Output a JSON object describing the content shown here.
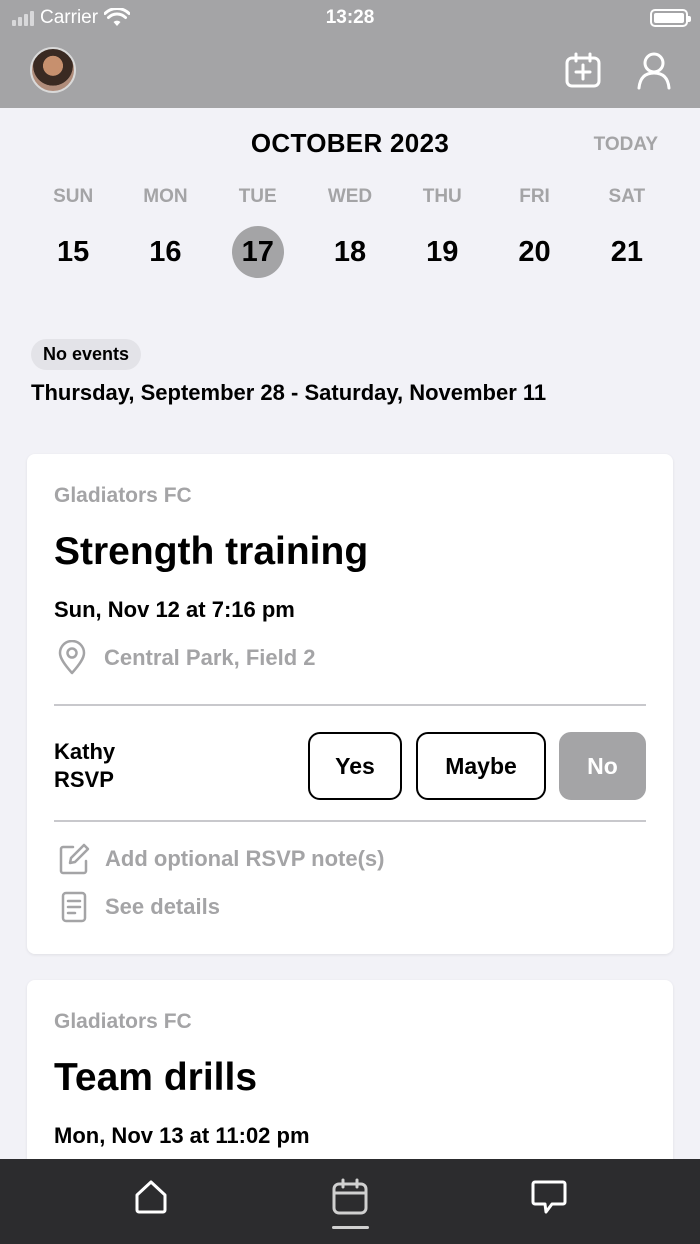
{
  "status_bar": {
    "carrier": "Carrier",
    "time": "13:28"
  },
  "header": {
    "icons": [
      "avatar",
      "calendar-add-icon",
      "profile-icon"
    ]
  },
  "calendar": {
    "month_title": "OCTOBER 2023",
    "today_label": "TODAY",
    "days": [
      {
        "name": "SUN",
        "num": "15"
      },
      {
        "name": "MON",
        "num": "16"
      },
      {
        "name": "TUE",
        "num": "17",
        "selected": true
      },
      {
        "name": "WED",
        "num": "18"
      },
      {
        "name": "THU",
        "num": "19"
      },
      {
        "name": "FRI",
        "num": "20"
      },
      {
        "name": "SAT",
        "num": "21"
      }
    ]
  },
  "no_events": {
    "badge": "No events",
    "range": "Thursday, September 28 - Saturday, November 11"
  },
  "events": [
    {
      "team": "Gladiators FC",
      "title": "Strength training",
      "when": "Sun, Nov 12 at 7:16 pm",
      "location": "Central Park, Field 2",
      "rsvp_label_line1": "Kathy",
      "rsvp_label_line2": "RSVP",
      "rsvp_options": {
        "yes": "Yes",
        "maybe": "Maybe",
        "no": "No"
      },
      "rsvp_selected": "No",
      "add_note": "Add optional RSVP note(s)",
      "see_details": "See details"
    },
    {
      "team": "Gladiators FC",
      "title": "Team drills",
      "when": "Mon, Nov 13 at 11:02 pm"
    }
  ],
  "tabbar": {
    "items": [
      "home-icon",
      "calendar-icon",
      "chat-icon"
    ],
    "active": "calendar-icon"
  },
  "colors": {
    "header_bg": "#a4a4a6",
    "page_bg": "#f2f2f7",
    "tabbar_bg": "#2c2c2e",
    "muted": "#a4a4a6"
  }
}
